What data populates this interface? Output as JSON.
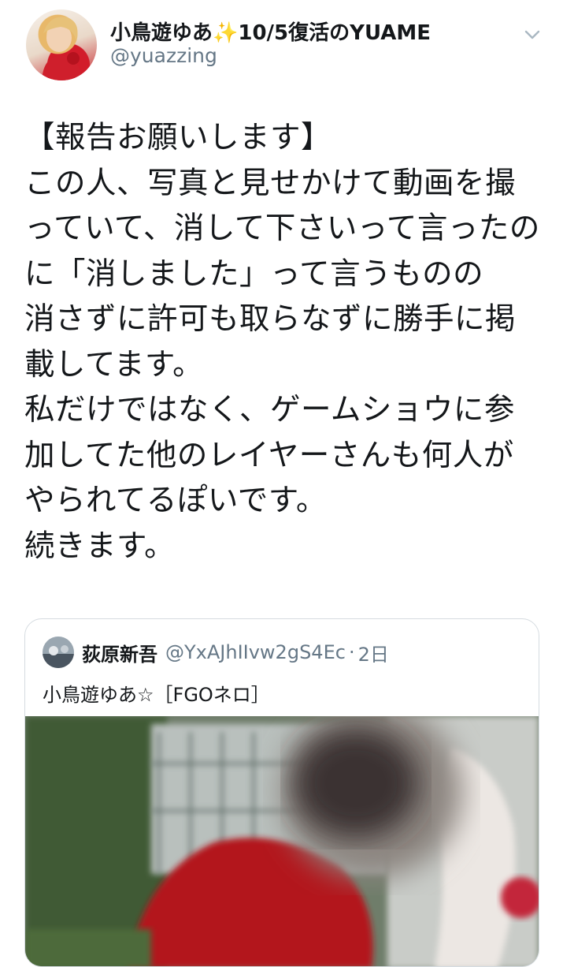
{
  "tweet": {
    "author": {
      "display_name": "小鳥遊ゆあ✨10/5復活のYUAME",
      "handle": "@yuazzing",
      "avatar_icon": "user-avatar"
    },
    "menu_icon": "chevron-down-icon",
    "text_lines": [
      "【報告お願いします】",
      "この人、写真と見せかけて動画を撮",
      "っていて、消して下さいって言ったの",
      "に「消しました」って言うものの",
      "消さずに許可も取らなずに勝手に掲",
      "載してます。",
      "私だけではなく、ゲームショウに参",
      "加してた他のレイヤーさんも何人が",
      "やられてるぽいです。",
      "続きます。"
    ]
  },
  "quoted_tweet": {
    "author_name": "荻原新吾",
    "author_handle": "@YxAJhIIvw2gS4Ec",
    "separator": "·",
    "timestamp": "2日",
    "text": "小鳥遊ゆあ☆［FGOネロ］",
    "media": "blurred-photo"
  },
  "colors": {
    "text": "#14171a",
    "secondary": "#657786",
    "border": "#d5dbe0"
  }
}
